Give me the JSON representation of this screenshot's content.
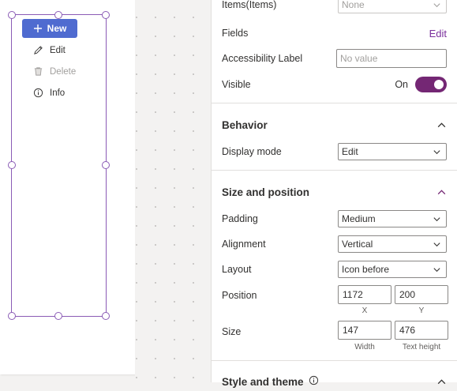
{
  "canvas": {
    "buttons": {
      "new_label": "New",
      "edit_label": "Edit",
      "delete_label": "Delete",
      "info_label": "Info"
    }
  },
  "properties": {
    "items": {
      "label": "Items(Items)",
      "value": "None"
    },
    "fields": {
      "label": "Fields",
      "link": "Edit"
    },
    "accessibility": {
      "label": "Accessibility Label",
      "placeholder": "No value"
    },
    "visible": {
      "label": "Visible",
      "state": "On"
    },
    "behavior": {
      "title": "Behavior",
      "display_mode": {
        "label": "Display mode",
        "value": "Edit"
      }
    },
    "size_position": {
      "title": "Size and position",
      "padding": {
        "label": "Padding",
        "value": "Medium"
      },
      "alignment": {
        "label": "Alignment",
        "value": "Vertical"
      },
      "layout": {
        "label": "Layout",
        "value": "Icon before"
      },
      "position": {
        "label": "Position",
        "x": "1172",
        "y": "200",
        "x_caption": "X",
        "y_caption": "Y"
      },
      "size": {
        "label": "Size",
        "width": "147",
        "height": "476",
        "width_caption": "Width",
        "height_caption": "Text height"
      }
    },
    "style_theme": {
      "title": "Style and theme"
    }
  },
  "colors": {
    "accent_button": "#4f6bd0",
    "toggle_on": "#742774",
    "selection": "#8a5bb5"
  }
}
